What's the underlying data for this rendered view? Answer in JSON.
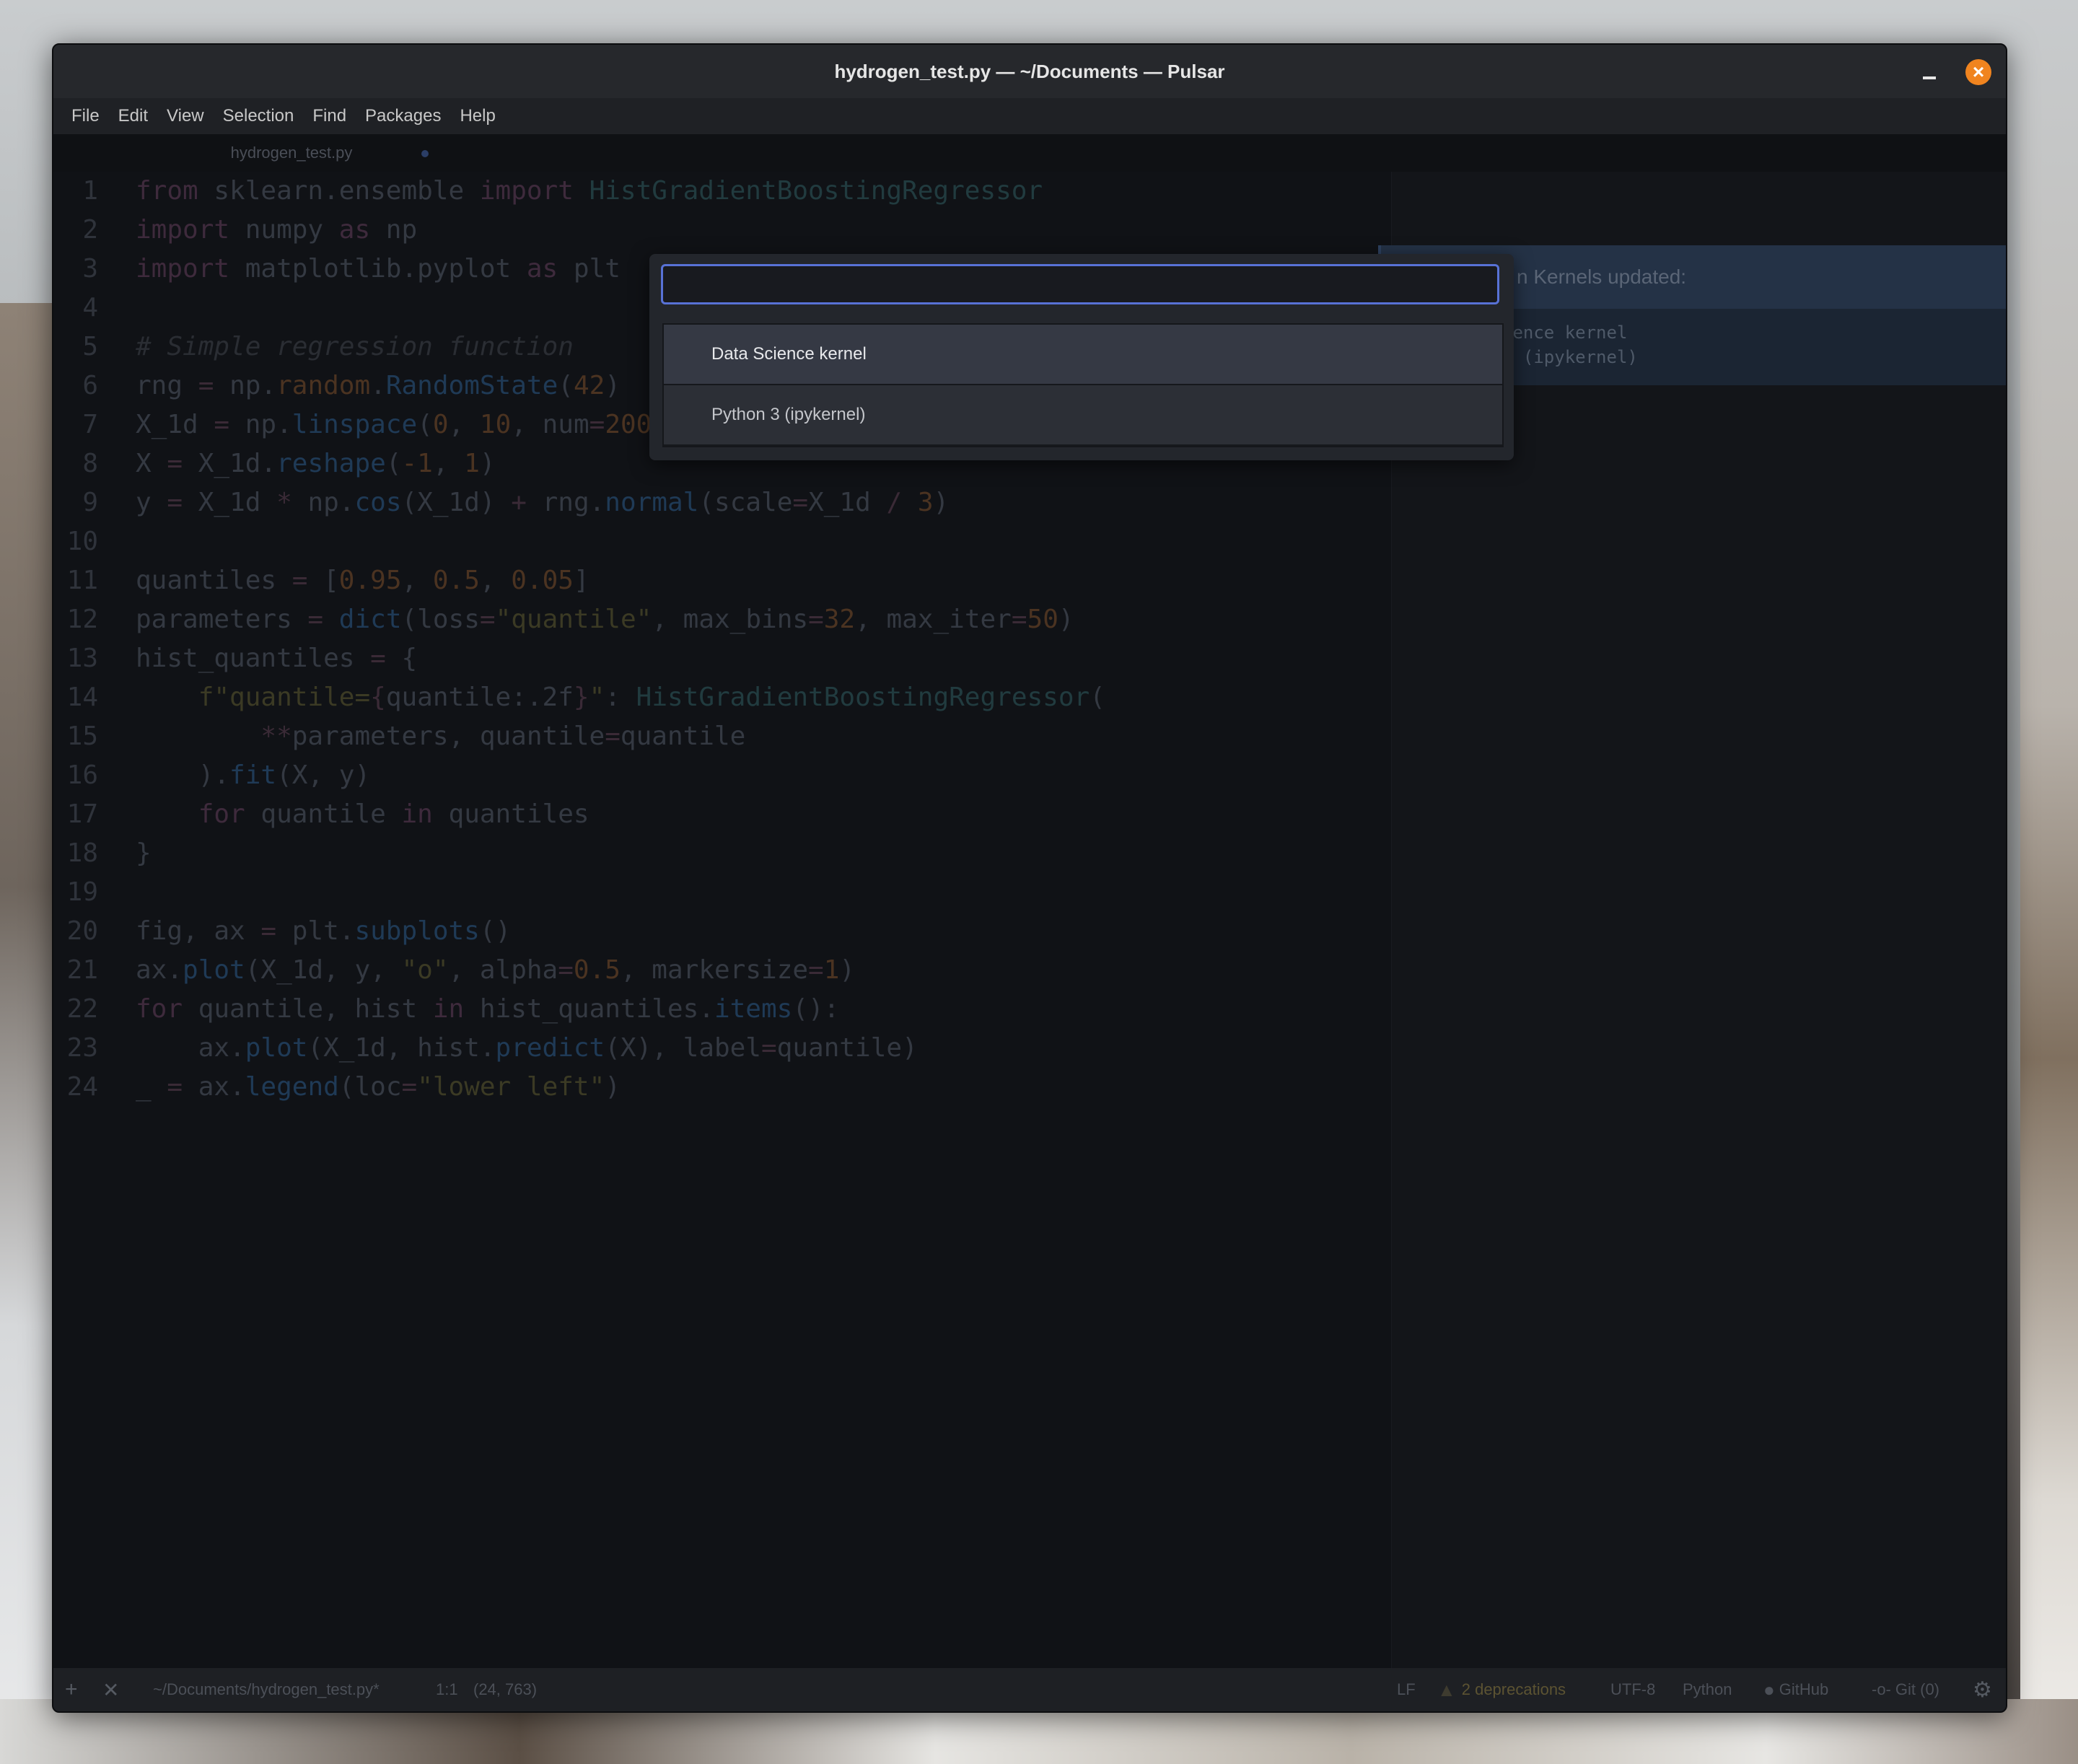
{
  "window": {
    "title": "hydrogen_test.py — ~/Documents — Pulsar"
  },
  "menu": [
    "File",
    "Edit",
    "View",
    "Selection",
    "Find",
    "Packages",
    "Help"
  ],
  "tab": {
    "label": "hydrogen_test.py",
    "modified": true
  },
  "code": {
    "lines": [
      [
        [
          "kw",
          "from"
        ],
        [
          "plain",
          " sklearn.ensemble "
        ],
        [
          "kw",
          "import"
        ],
        [
          "cls",
          " HistGradientBoostingRegressor"
        ]
      ],
      [
        [
          "kw",
          "import"
        ],
        [
          "plain",
          " numpy "
        ],
        [
          "kw",
          "as"
        ],
        [
          "plain",
          " np"
        ]
      ],
      [
        [
          "kw",
          "import"
        ],
        [
          "plain",
          " matplotlib.pyplot "
        ],
        [
          "kw",
          "as"
        ],
        [
          "plain",
          " plt"
        ]
      ],
      [],
      [
        [
          "cm",
          "# Simple regression function"
        ]
      ],
      [
        [
          "plain",
          "rng "
        ],
        [
          "op",
          "="
        ],
        [
          "plain",
          " np."
        ],
        [
          "num",
          "random"
        ],
        [
          "plain",
          "."
        ],
        [
          "fn",
          "RandomState"
        ],
        [
          "plain",
          "("
        ],
        [
          "num",
          "42"
        ],
        [
          "plain",
          ")"
        ]
      ],
      [
        [
          "plain",
          "X_1d "
        ],
        [
          "op",
          "="
        ],
        [
          "plain",
          " np."
        ],
        [
          "fn",
          "linspace"
        ],
        [
          "plain",
          "("
        ],
        [
          "num",
          "0"
        ],
        [
          "plain",
          ", "
        ],
        [
          "num",
          "10"
        ],
        [
          "plain",
          ", num"
        ],
        [
          "op",
          "="
        ],
        [
          "num",
          "2000"
        ],
        [
          "plain",
          ")"
        ]
      ],
      [
        [
          "plain",
          "X "
        ],
        [
          "op",
          "="
        ],
        [
          "plain",
          " X_1d."
        ],
        [
          "fn",
          "reshape"
        ],
        [
          "plain",
          "("
        ],
        [
          "num",
          "-1"
        ],
        [
          "plain",
          ", "
        ],
        [
          "num",
          "1"
        ],
        [
          "plain",
          ")"
        ]
      ],
      [
        [
          "plain",
          "y "
        ],
        [
          "op",
          "="
        ],
        [
          "plain",
          " X_1d "
        ],
        [
          "op",
          "*"
        ],
        [
          "plain",
          " np."
        ],
        [
          "fn",
          "cos"
        ],
        [
          "plain",
          "(X_1d) "
        ],
        [
          "op",
          "+"
        ],
        [
          "plain",
          " rng."
        ],
        [
          "fn",
          "normal"
        ],
        [
          "plain",
          "(scale"
        ],
        [
          "op",
          "="
        ],
        [
          "plain",
          "X_1d "
        ],
        [
          "op",
          "/"
        ],
        [
          "plain",
          " "
        ],
        [
          "num",
          "3"
        ],
        [
          "plain",
          ")"
        ]
      ],
      [],
      [
        [
          "plain",
          "quantiles "
        ],
        [
          "op",
          "="
        ],
        [
          "plain",
          " ["
        ],
        [
          "num",
          "0.95"
        ],
        [
          "plain",
          ", "
        ],
        [
          "num",
          "0.5"
        ],
        [
          "plain",
          ", "
        ],
        [
          "num",
          "0.05"
        ],
        [
          "plain",
          "]"
        ]
      ],
      [
        [
          "plain",
          "parameters "
        ],
        [
          "op",
          "="
        ],
        [
          "plain",
          " "
        ],
        [
          "fn",
          "dict"
        ],
        [
          "plain",
          "(loss"
        ],
        [
          "op",
          "="
        ],
        [
          "str",
          "\"quantile\""
        ],
        [
          "plain",
          ", max_bins"
        ],
        [
          "op",
          "="
        ],
        [
          "num",
          "32"
        ],
        [
          "plain",
          ", max_iter"
        ],
        [
          "op",
          "="
        ],
        [
          "num",
          "50"
        ],
        [
          "plain",
          ")"
        ]
      ],
      [
        [
          "plain",
          "hist_quantiles "
        ],
        [
          "op",
          "="
        ],
        [
          "plain",
          " {"
        ]
      ],
      [
        [
          "plain",
          "    "
        ],
        [
          "str",
          "f\"quantile="
        ],
        [
          "op",
          "{"
        ],
        [
          "plain",
          "quantile:.2f"
        ],
        [
          "op",
          "}"
        ],
        [
          "str",
          "\""
        ],
        [
          "plain",
          ": "
        ],
        [
          "cls",
          "HistGradientBoostingRegressor"
        ],
        [
          "plain",
          "("
        ]
      ],
      [
        [
          "plain",
          "        "
        ],
        [
          "op",
          "**"
        ],
        [
          "plain",
          "parameters, quantile"
        ],
        [
          "op",
          "="
        ],
        [
          "plain",
          "quantile"
        ]
      ],
      [
        [
          "plain",
          "    )."
        ],
        [
          "fn",
          "fit"
        ],
        [
          "plain",
          "(X, y)"
        ]
      ],
      [
        [
          "plain",
          "    "
        ],
        [
          "kw",
          "for"
        ],
        [
          "plain",
          " quantile "
        ],
        [
          "kw",
          "in"
        ],
        [
          "plain",
          " quantiles"
        ]
      ],
      [
        [
          "plain",
          "}"
        ]
      ],
      [],
      [
        [
          "plain",
          "fig, ax "
        ],
        [
          "op",
          "="
        ],
        [
          "plain",
          " plt."
        ],
        [
          "fn",
          "subplots"
        ],
        [
          "plain",
          "()"
        ]
      ],
      [
        [
          "plain",
          "ax."
        ],
        [
          "fn",
          "plot"
        ],
        [
          "plain",
          "(X_1d, y, "
        ],
        [
          "str",
          "\"o\""
        ],
        [
          "plain",
          ", alpha"
        ],
        [
          "op",
          "="
        ],
        [
          "num",
          "0.5"
        ],
        [
          "plain",
          ", markersize"
        ],
        [
          "op",
          "="
        ],
        [
          "num",
          "1"
        ],
        [
          "plain",
          ")"
        ]
      ],
      [
        [
          "kw",
          "for"
        ],
        [
          "plain",
          " quantile, hist "
        ],
        [
          "kw",
          "in"
        ],
        [
          "plain",
          " hist_quantiles."
        ],
        [
          "fn",
          "items"
        ],
        [
          "plain",
          "():"
        ]
      ],
      [
        [
          "plain",
          "    ax."
        ],
        [
          "fn",
          "plot"
        ],
        [
          "plain",
          "(X_1d, hist."
        ],
        [
          "fn",
          "predict"
        ],
        [
          "plain",
          "(X), label"
        ],
        [
          "op",
          "="
        ],
        [
          "plain",
          "quantile)"
        ]
      ],
      [
        [
          "plain",
          "_ "
        ],
        [
          "op",
          "="
        ],
        [
          "plain",
          " ax."
        ],
        [
          "fn",
          "legend"
        ],
        [
          "plain",
          "(loc"
        ],
        [
          "op",
          "="
        ],
        [
          "str",
          "\"lower left\""
        ],
        [
          "plain",
          ")"
        ]
      ]
    ]
  },
  "notification": {
    "title_visible": "n Kernels updated:",
    "body_lines": [
      "ience kernel",
      "3 (ipykernel)"
    ]
  },
  "kernel_selector": {
    "input_value": "",
    "items": [
      "Data Science kernel",
      "Python 3 (ipykernel)"
    ],
    "selected_index": 0
  },
  "statusbar": {
    "add_icon": "plus-icon",
    "close_icon": "close-icon",
    "file_path": "~/Documents/hydrogen_test.py*",
    "cursor_position": "1:1",
    "selection": "(24, 763)",
    "line_ending": "LF",
    "deprecations": "2 deprecations",
    "encoding": "UTF-8",
    "grammar": "Python",
    "github": "GitHub",
    "git": "Git (0)",
    "settings_icon": "gear-icon"
  },
  "colors": {
    "accent": "#5872d6",
    "close_button": "#f0841f",
    "editor_background": "#101216"
  }
}
